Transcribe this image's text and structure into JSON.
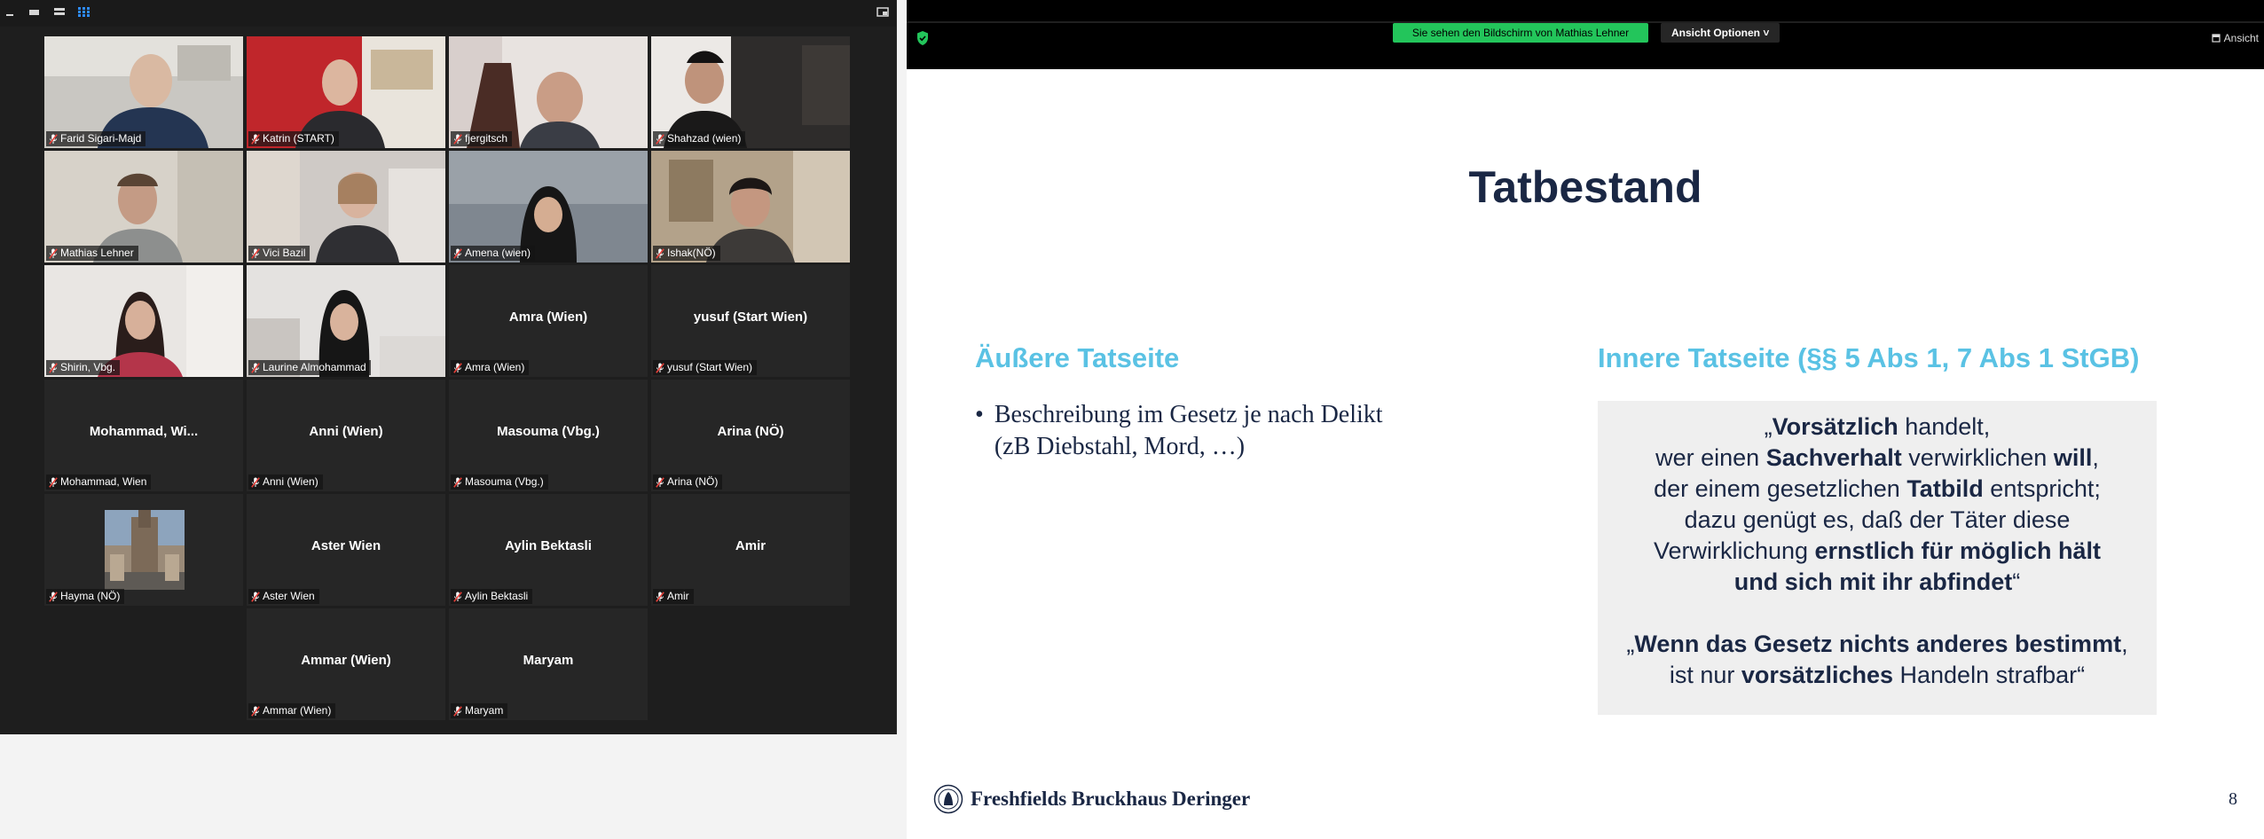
{
  "gallery": {
    "tiles": [
      {
        "label": "Farid Sigari-Majd",
        "center": "",
        "video": "v1"
      },
      {
        "label": "Katrin (START)",
        "center": "",
        "video": "v2"
      },
      {
        "label": "fjergitsch",
        "center": "",
        "video": "v3"
      },
      {
        "label": "Shahzad (wien)",
        "center": "",
        "video": "v4"
      },
      {
        "label": "Mathias Lehner",
        "center": "",
        "video": "v5"
      },
      {
        "label": "Vici Bazil",
        "center": "",
        "video": "v6"
      },
      {
        "label": "Amena (wien)",
        "center": "",
        "video": "v7"
      },
      {
        "label": "Ishak(NÖ)",
        "center": "",
        "video": "v8"
      },
      {
        "label": "Shirin, Vbg.",
        "center": "",
        "video": "v9"
      },
      {
        "label": "Laurine Almohammad",
        "center": "",
        "video": "v10"
      },
      {
        "label": "Amra (Wien)",
        "center": "Amra (Wien)",
        "video": ""
      },
      {
        "label": "yusuf (Start Wien)",
        "center": "yusuf (Start Wien)",
        "video": ""
      },
      {
        "label": "Mohammad, Wien",
        "center": "Mohammad,  Wi...",
        "video": ""
      },
      {
        "label": "Anni (Wien)",
        "center": "Anni (Wien)",
        "video": ""
      },
      {
        "label": "Masouma (Vbg.)",
        "center": "Masouma (Vbg.)",
        "video": ""
      },
      {
        "label": "Arina (NÖ)",
        "center": "Arina (NÖ)",
        "video": ""
      },
      {
        "label": "Hayma (NÖ)",
        "center": "",
        "video": "photo"
      },
      {
        "label": "Aster Wien",
        "center": "Aster Wien",
        "video": ""
      },
      {
        "label": "Aylin Bektasli",
        "center": "Aylin Bektasli",
        "video": ""
      },
      {
        "label": "Amir",
        "center": "Amir",
        "video": ""
      },
      {
        "label": "Ammar (Wien)",
        "center": "Ammar (Wien)",
        "video": ""
      },
      {
        "label": "Maryam",
        "center": "Maryam",
        "video": ""
      }
    ]
  },
  "share": {
    "sharing_text": "Sie sehen den Bildschirm von Mathias Lehner",
    "view_options": "Ansicht Optionen ˅",
    "view_button": "Ansicht",
    "slide": {
      "title": "Tatbestand",
      "outer_heading": "Äußere Tatseite",
      "bullet_line1": "Beschreibung im Gesetz je nach Delikt",
      "bullet_line2": "(zB Diebstahl, Mord, …)",
      "inner_heading": "Innere Tatseite (§§ 5 Abs 1, 7 Abs 1 StGB)",
      "quote1": {
        "l1a": "„",
        "l1b": "Vorsätzlich",
        "l1c": " handelt,",
        "l2a": "wer einen ",
        "l2b": "Sachverhalt",
        "l2c": " verwirklichen ",
        "l2d": "will",
        "l2e": ",",
        "l3a": "der einem gesetzlichen ",
        "l3b": "Tatbild",
        "l3c": " entspricht;",
        "l4": "dazu genügt es, daß der Täter diese",
        "l5a": "Verwirklichung ",
        "l5b": "ernstlich für möglich hält",
        "l6a": "und sich mit ihr abfindet",
        "l6b": "“"
      },
      "quote2": {
        "l1a": "„",
        "l1b": "Wenn das Gesetz nichts anderes bestimmt",
        "l1c": ",",
        "l2a": "ist nur ",
        "l2b": "vorsätzliches",
        "l2c": " Handeln strafbar“"
      },
      "footer_logo": "Freshfields Bruckhaus Deringer",
      "page_number": "8"
    }
  },
  "colors": {
    "accent_green": "#23c55b",
    "slide_navy": "#1a2744",
    "slide_cyan": "#5ac2e4",
    "active_speaker": "#d7cf3e"
  }
}
